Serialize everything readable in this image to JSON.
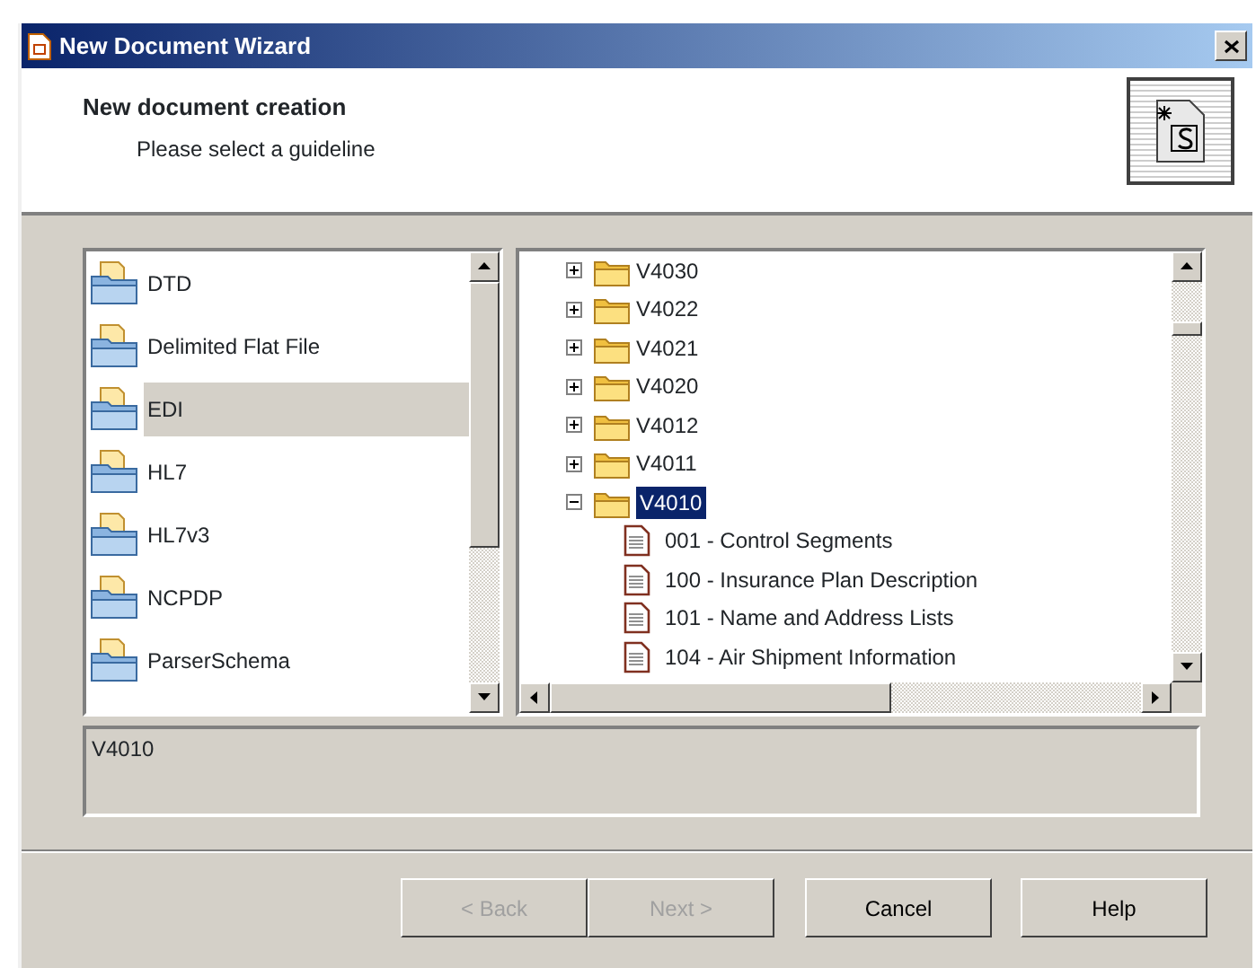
{
  "window": {
    "title": "New Document Wizard"
  },
  "header": {
    "title": "New document creation",
    "subtitle": "Please select a guideline"
  },
  "guidelines": [
    {
      "label": "DTD",
      "selected": false
    },
    {
      "label": "Delimited Flat File",
      "selected": false
    },
    {
      "label": "EDI",
      "selected": true
    },
    {
      "label": "HL7",
      "selected": false
    },
    {
      "label": "HL7v3",
      "selected": false
    },
    {
      "label": "NCPDP",
      "selected": false
    },
    {
      "label": "ParserSchema",
      "selected": false
    }
  ],
  "tree": [
    {
      "label": "V4030",
      "expanded": false,
      "selected": false
    },
    {
      "label": "V4022",
      "expanded": false,
      "selected": false
    },
    {
      "label": "V4021",
      "expanded": false,
      "selected": false
    },
    {
      "label": "V4020",
      "expanded": false,
      "selected": false
    },
    {
      "label": "V4012",
      "expanded": false,
      "selected": false
    },
    {
      "label": "V4011",
      "expanded": false,
      "selected": false
    },
    {
      "label": "V4010",
      "expanded": true,
      "selected": true,
      "children": [
        {
          "label": "001 - Control Segments",
          "selected": false
        },
        {
          "label": "100 - Insurance Plan Description",
          "selected": false
        },
        {
          "label": "101 - Name and Address Lists",
          "selected": false
        },
        {
          "label": "104 - Air Shipment Information",
          "selected": false
        }
      ]
    }
  ],
  "description": "V4010",
  "buttons": [
    {
      "label": "< Back",
      "disabled": true
    },
    {
      "label": "Next >",
      "disabled": true
    },
    {
      "label": "Cancel",
      "disabled": false
    },
    {
      "label": "Help",
      "disabled": false
    }
  ]
}
